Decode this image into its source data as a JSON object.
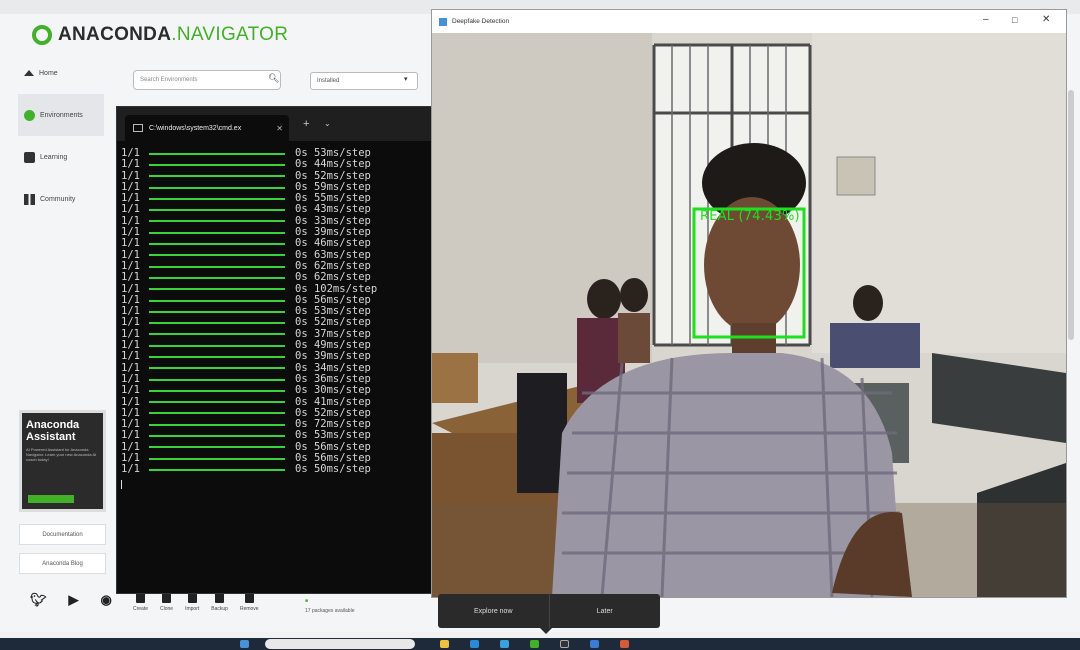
{
  "navigator": {
    "logo_primary": "ANACONDA",
    "logo_secondary": ".NAVIGATOR",
    "sidebar": [
      {
        "label": "Home",
        "icon": "home-icon"
      },
      {
        "label": "Environments",
        "icon": "environments-icon"
      },
      {
        "label": "Learning",
        "icon": "learning-icon"
      },
      {
        "label": "Community",
        "icon": "community-icon"
      }
    ],
    "search_placeholder": "Search Environments",
    "filter_value": "Installed",
    "assistant": {
      "title": "Anaconda Assistant",
      "description": "AI Powered Assistant for Anaconda Navigator. Learn your new Anaconda AI coach today!"
    },
    "docs_link": "Documentation",
    "blog_link": "Anaconda Blog",
    "env_actions": [
      "Create",
      "Clone",
      "Import",
      "Backup",
      "Remove"
    ],
    "package_status": "17 packages available"
  },
  "terminal": {
    "tab_title": "C:\\windows\\system32\\cmd.ex",
    "lines": [
      {
        "step": "1/1",
        "time": "0s 53ms/step"
      },
      {
        "step": "1/1",
        "time": "0s 44ms/step"
      },
      {
        "step": "1/1",
        "time": "0s 52ms/step"
      },
      {
        "step": "1/1",
        "time": "0s 59ms/step"
      },
      {
        "step": "1/1",
        "time": "0s 55ms/step"
      },
      {
        "step": "1/1",
        "time": "0s 43ms/step"
      },
      {
        "step": "1/1",
        "time": "0s 33ms/step"
      },
      {
        "step": "1/1",
        "time": "0s 39ms/step"
      },
      {
        "step": "1/1",
        "time": "0s 46ms/step"
      },
      {
        "step": "1/1",
        "time": "0s 63ms/step"
      },
      {
        "step": "1/1",
        "time": "0s 62ms/step"
      },
      {
        "step": "1/1",
        "time": "0s 62ms/step"
      },
      {
        "step": "1/1",
        "time": "0s 102ms/step"
      },
      {
        "step": "1/1",
        "time": "0s 56ms/step"
      },
      {
        "step": "1/1",
        "time": "0s 53ms/step"
      },
      {
        "step": "1/1",
        "time": "0s 52ms/step"
      },
      {
        "step": "1/1",
        "time": "0s 37ms/step"
      },
      {
        "step": "1/1",
        "time": "0s 49ms/step"
      },
      {
        "step": "1/1",
        "time": "0s 39ms/step"
      },
      {
        "step": "1/1",
        "time": "0s 34ms/step"
      },
      {
        "step": "1/1",
        "time": "0s 36ms/step"
      },
      {
        "step": "1/1",
        "time": "0s 30ms/step"
      },
      {
        "step": "1/1",
        "time": "0s 41ms/step"
      },
      {
        "step": "1/1",
        "time": "0s 52ms/step"
      },
      {
        "step": "1/1",
        "time": "0s 72ms/step"
      },
      {
        "step": "1/1",
        "time": "0s 53ms/step"
      },
      {
        "step": "1/1",
        "time": "0s 56ms/step"
      },
      {
        "step": "1/1",
        "time": "0s 56ms/step"
      },
      {
        "step": "1/1",
        "time": "0s 50ms/step"
      }
    ]
  },
  "deepfake": {
    "window_title": "Deepfake Detection",
    "detection_label": "REAL (74.43%)",
    "box_color": "#1fe01f"
  },
  "popup": {
    "explore_label": "Explore now",
    "later_label": "Later"
  },
  "colors": {
    "brand_green": "#43b02a",
    "terminal_bg": "#0c0c0c",
    "progress_green": "#3bd13b"
  }
}
